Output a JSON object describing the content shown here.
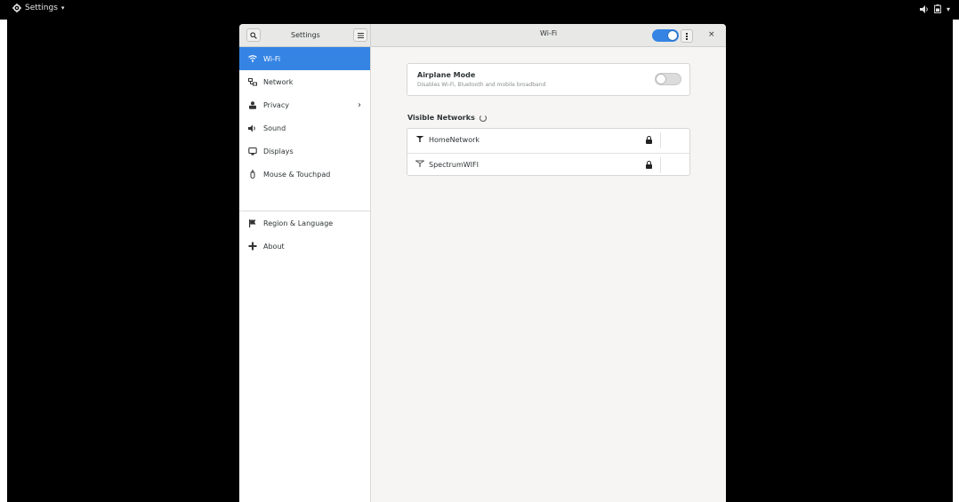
{
  "topbar": {
    "app_menu_label": "Settings",
    "app_menu_caret": "▾",
    "status_volume_icon": "speaker-icon",
    "status_battery_icon": "battery-icon",
    "status_caret": "▾"
  },
  "window": {
    "sidebar_title": "Settings",
    "main_title": "Wi-Fi",
    "wifi_enabled": true,
    "close_label": "×"
  },
  "sidebar": {
    "items": [
      {
        "label": "Wi-Fi",
        "icon": "wifi-icon",
        "active": true
      },
      {
        "label": "Network",
        "icon": "network-icon"
      },
      {
        "label": "Privacy",
        "icon": "privacy-icon",
        "has_submenu": true
      },
      {
        "label": "Sound",
        "icon": "speaker-icon"
      },
      {
        "label": "Displays",
        "icon": "display-icon"
      },
      {
        "label": "Mouse & Touchpad",
        "icon": "mouse-icon"
      },
      {
        "label": "Region & Language",
        "icon": "flag-icon"
      },
      {
        "label": "About",
        "icon": "about-icon"
      }
    ]
  },
  "content": {
    "airplane": {
      "title": "Airplane Mode",
      "subtitle": "Disables Wi-Fi, Bluetooth and mobile broadband",
      "enabled": false
    },
    "visible_networks_title": "Visible Networks",
    "networks": [
      {
        "name": "HomeNetwork",
        "secured": true
      },
      {
        "name": "SpectrumWIFI",
        "secured": true
      }
    ]
  },
  "colors": {
    "accent": "#3584e4",
    "desktop": "#000000",
    "window_bg": "#f6f5f4"
  }
}
